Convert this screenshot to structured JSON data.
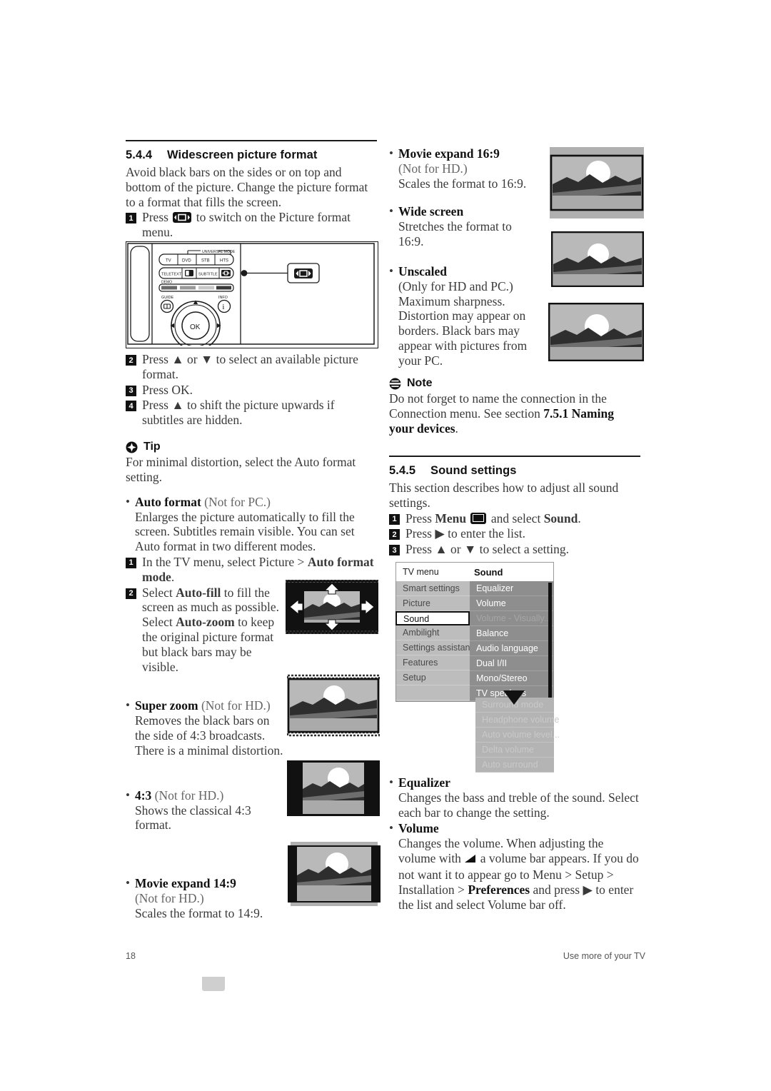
{
  "page": {
    "number": "18",
    "footer_right": "Use more of your TV"
  },
  "left_column": {
    "section": {
      "number": "5.4.4",
      "title": "Widescreen picture format"
    },
    "intro": "Avoid black bars on the sides or on top and bottom of the picture. Change the picture format to a format that fills the screen.",
    "steps": [
      {
        "n": "1",
        "text_before": "Press",
        "icon": "picture-format-icon",
        "text_after": "to switch on the Picture format menu."
      },
      {
        "n": "2",
        "text": "Press ▲ or ▼ to select an available picture format."
      },
      {
        "n": "3",
        "text": "Press OK."
      },
      {
        "n": "4",
        "text": "Press ▲ to shift the picture upwards if subtitles are hidden."
      }
    ],
    "remote": {
      "universal_mode_label": "UNIVERSAL MODE",
      "mode_buttons": [
        "TV",
        "DVD",
        "STB",
        "HTS"
      ],
      "row2": [
        "TELETEXT",
        "SUBTITLE"
      ],
      "demo_label": "DEMO",
      "guide_label": "GUIDE",
      "info_label": "INFO",
      "ok_label": "OK",
      "callout_icon": "picture-format-icon"
    },
    "tip": {
      "icon": "tip-icon",
      "title": "Tip",
      "text": "For minimal distortion, select the Auto format setting."
    },
    "formats": [
      {
        "name": "Auto format",
        "qualifier": "(Not for PC.)",
        "body": "Enlarges the picture automatically to fill the screen. Subtitles remain visible. You can set Auto format in two different modes.",
        "steps": [
          {
            "n": "1",
            "text": "In the TV menu, select Picture > ",
            "bold": "Auto format mode",
            "tail": "."
          },
          {
            "n": "2",
            "text_a": "Select ",
            "bold_a": "Auto-fill",
            "text_b": " to fill the screen as much as possible. Select ",
            "bold_b": "Auto-zoom",
            "text_c": " to keep the original picture format but black bars may be visible."
          }
        ],
        "image": "auto-format-illustration"
      },
      {
        "name": "Super zoom",
        "qualifier": "(Not for HD.)",
        "body": "Removes the black bars on the side of 4:3 broadcasts. There is a minimal distortion.",
        "image": "super-zoom-illustration"
      },
      {
        "name": "4:3",
        "qualifier": "(Not for HD.)",
        "body": "Shows the classical 4:3 format.",
        "image": "four-three-illustration"
      },
      {
        "name": "Movie expand 14:9",
        "qualifier": "(Not for HD.)",
        "body": "Scales the format to 14:9.",
        "image": "movie-expand-14-9-illustration"
      }
    ]
  },
  "right_column": {
    "formats": [
      {
        "name": "Movie expand 16:9",
        "qualifier": "(Not for HD.)",
        "body": "Scales the format to 16:9.",
        "image": "movie-expand-16-9-illustration"
      },
      {
        "name": "Wide screen",
        "qualifier": "",
        "body": "Stretches the format to 16:9.",
        "image": "wide-screen-illustration"
      },
      {
        "name": "Unscaled",
        "qualifier": "",
        "body": "(Only for HD and PC.) Maximum sharpness. Distortion may appear on borders. Black bars may appear with pictures from your PC.",
        "image": "unscaled-illustration"
      }
    ],
    "note": {
      "icon": "note-icon",
      "title": "Note",
      "text_a": "Do not forget to name the connection in the Connection menu. See section ",
      "bold": "7.5.1 Naming your devices",
      "text_b": "."
    },
    "section": {
      "number": "5.4.5",
      "title": "Sound settings"
    },
    "intro": "This section describes how to adjust all sound settings.",
    "steps": [
      {
        "n": "1",
        "text_a": "Press ",
        "bold_a": "Menu",
        "icon": "menu-icon",
        "text_b": " and select ",
        "bold_b": "Sound",
        "tail": "."
      },
      {
        "n": "2",
        "text": "Press ▶ to enter the list."
      },
      {
        "n": "3",
        "text": "Press ▲ or ▼ to select a setting."
      }
    ],
    "tv_menu": {
      "header_left": "TV menu",
      "header_right": "Sound",
      "left_items": [
        {
          "label": "Smart settings",
          "state": "normal"
        },
        {
          "label": "Picture",
          "state": "normal"
        },
        {
          "label": "Sound",
          "state": "selected"
        },
        {
          "label": "Ambilight",
          "state": "normal"
        },
        {
          "label": "Settings assistant",
          "state": "normal"
        },
        {
          "label": "Features",
          "state": "normal"
        },
        {
          "label": "Setup",
          "state": "normal"
        }
      ],
      "right_items": [
        {
          "label": "Equalizer",
          "state": "normal"
        },
        {
          "label": "Volume",
          "state": "normal"
        },
        {
          "label": "Volume - Visually...",
          "state": "disabled"
        },
        {
          "label": "Balance",
          "state": "normal"
        },
        {
          "label": "Audio language",
          "state": "normal"
        },
        {
          "label": "Dual I/II",
          "state": "normal"
        },
        {
          "label": "Mono/Stereo",
          "state": "normal"
        },
        {
          "label": "TV speakers",
          "state": "normal"
        }
      ],
      "overflow_items": [
        "Surround mode",
        "Headphone volume",
        "Auto volume level...",
        "Delta volume",
        "Auto surround"
      ],
      "scroll_indicator": "down-triangle-icon"
    },
    "settings": [
      {
        "name": "Equalizer",
        "body": "Changes the bass and treble of the sound. Select each bar to change the setting."
      },
      {
        "name": "Volume",
        "body_a": "Changes the volume. When adjusting the volume with ",
        "icon": "volume-icon",
        "body_b": " a volume bar appears. If you do not want it to appear go to Menu > Setup > Installation > ",
        "bold": "Preferences",
        "body_c": " and press ▶ to enter the list and select Volume bar off."
      }
    ]
  }
}
